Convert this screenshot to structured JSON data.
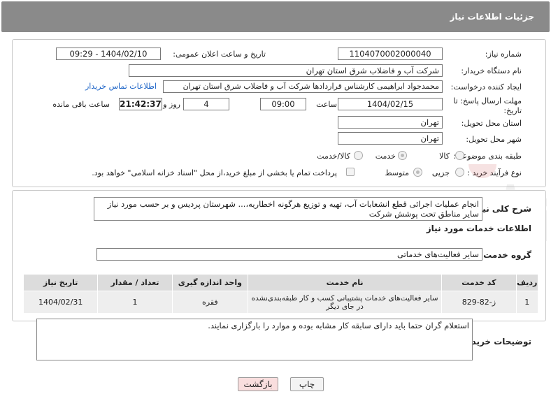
{
  "header": {
    "title": "جزئیات اطلاعات نیاز"
  },
  "fields": {
    "need_number_label": "شماره نیاز:",
    "need_number": "1104070002000040",
    "announce_label": "تاریخ و ساعت اعلان عمومی:",
    "announce_value": "1404/02/10 - 09:29",
    "buyer_org_label": "نام دستگاه خریدار:",
    "buyer_org": "شرکت آب و فاضلاب شرق استان تهران",
    "creator_label": "ایجاد کننده درخواست:",
    "creator": "محمدجواد ابراهیمی کارشناس قراردادها شرکت آب و فاضلاب شرق استان تهران",
    "contact_link": "اطلاعات تماس خریدار",
    "deadline_label_1": "مهلت ارسال پاسخ: تا",
    "deadline_label_2": "تاریخ:",
    "deadline_date": "1404/02/15",
    "time_label": "ساعت",
    "deadline_time": "09:00",
    "days_value": "4",
    "days_label": "روز و",
    "remaining_time": "21:42:37",
    "remaining_label": "ساعت باقی مانده",
    "province_label": "استان محل تحویل:",
    "province": "تهران",
    "city_label": "شهر محل تحویل:",
    "city": "تهران",
    "category_label": "طبقه بندی موضوعی:",
    "category_options": [
      "کالا",
      "خدمت",
      "کالا/خدمت"
    ],
    "category_selected": "خدمت",
    "process_label": "نوع فرآیند خرید :",
    "process_options": [
      "جزیی",
      "متوسط"
    ],
    "process_selected": "متوسط",
    "payment_note": "پرداخت تمام یا بخشی از مبلغ خرید،از محل \"اسناد خزانه اسلامی\" خواهد بود."
  },
  "summary": {
    "label": "شرح کلی نیاز:",
    "text": "انجام عملیات اجرائی قطع انشعابات آب، تهیه و توزیع هرگونه اخطاریه،... شهرستان پردیس و بر حسب مورد نیاز سایر مناطق تحت پوشش شرکت"
  },
  "services": {
    "section_title": "اطلاعات خدمات مورد نیاز",
    "group_label": "گروه خدمت:",
    "group_value": "سایر فعالیت‌های خدماتی",
    "columns": [
      "ردیف",
      "کد خدمت",
      "نام خدمت",
      "واحد اندازه گیری",
      "تعداد / مقدار",
      "تاریخ نیاز"
    ],
    "rows": [
      [
        "1",
        "ز-82-829",
        "سایر فعالیت‌های خدمات پشتیبانی کسب و کار طبقه‌بندی‌نشده در جای دیگر",
        "فقره",
        "1",
        "1404/02/31"
      ]
    ]
  },
  "buyer_notes": {
    "label": "توضیحات خریدار:",
    "text": "استعلام گران حتما باید دارای سابقه کار مشابه بوده و  موارد را بارگزاری نمایند."
  },
  "buttons": {
    "print": "چاپ",
    "back": "بازگشت"
  },
  "colors": {
    "header_bg": "#8a8a8a",
    "link": "#1a62c6",
    "back_btn": "#f9dede"
  }
}
